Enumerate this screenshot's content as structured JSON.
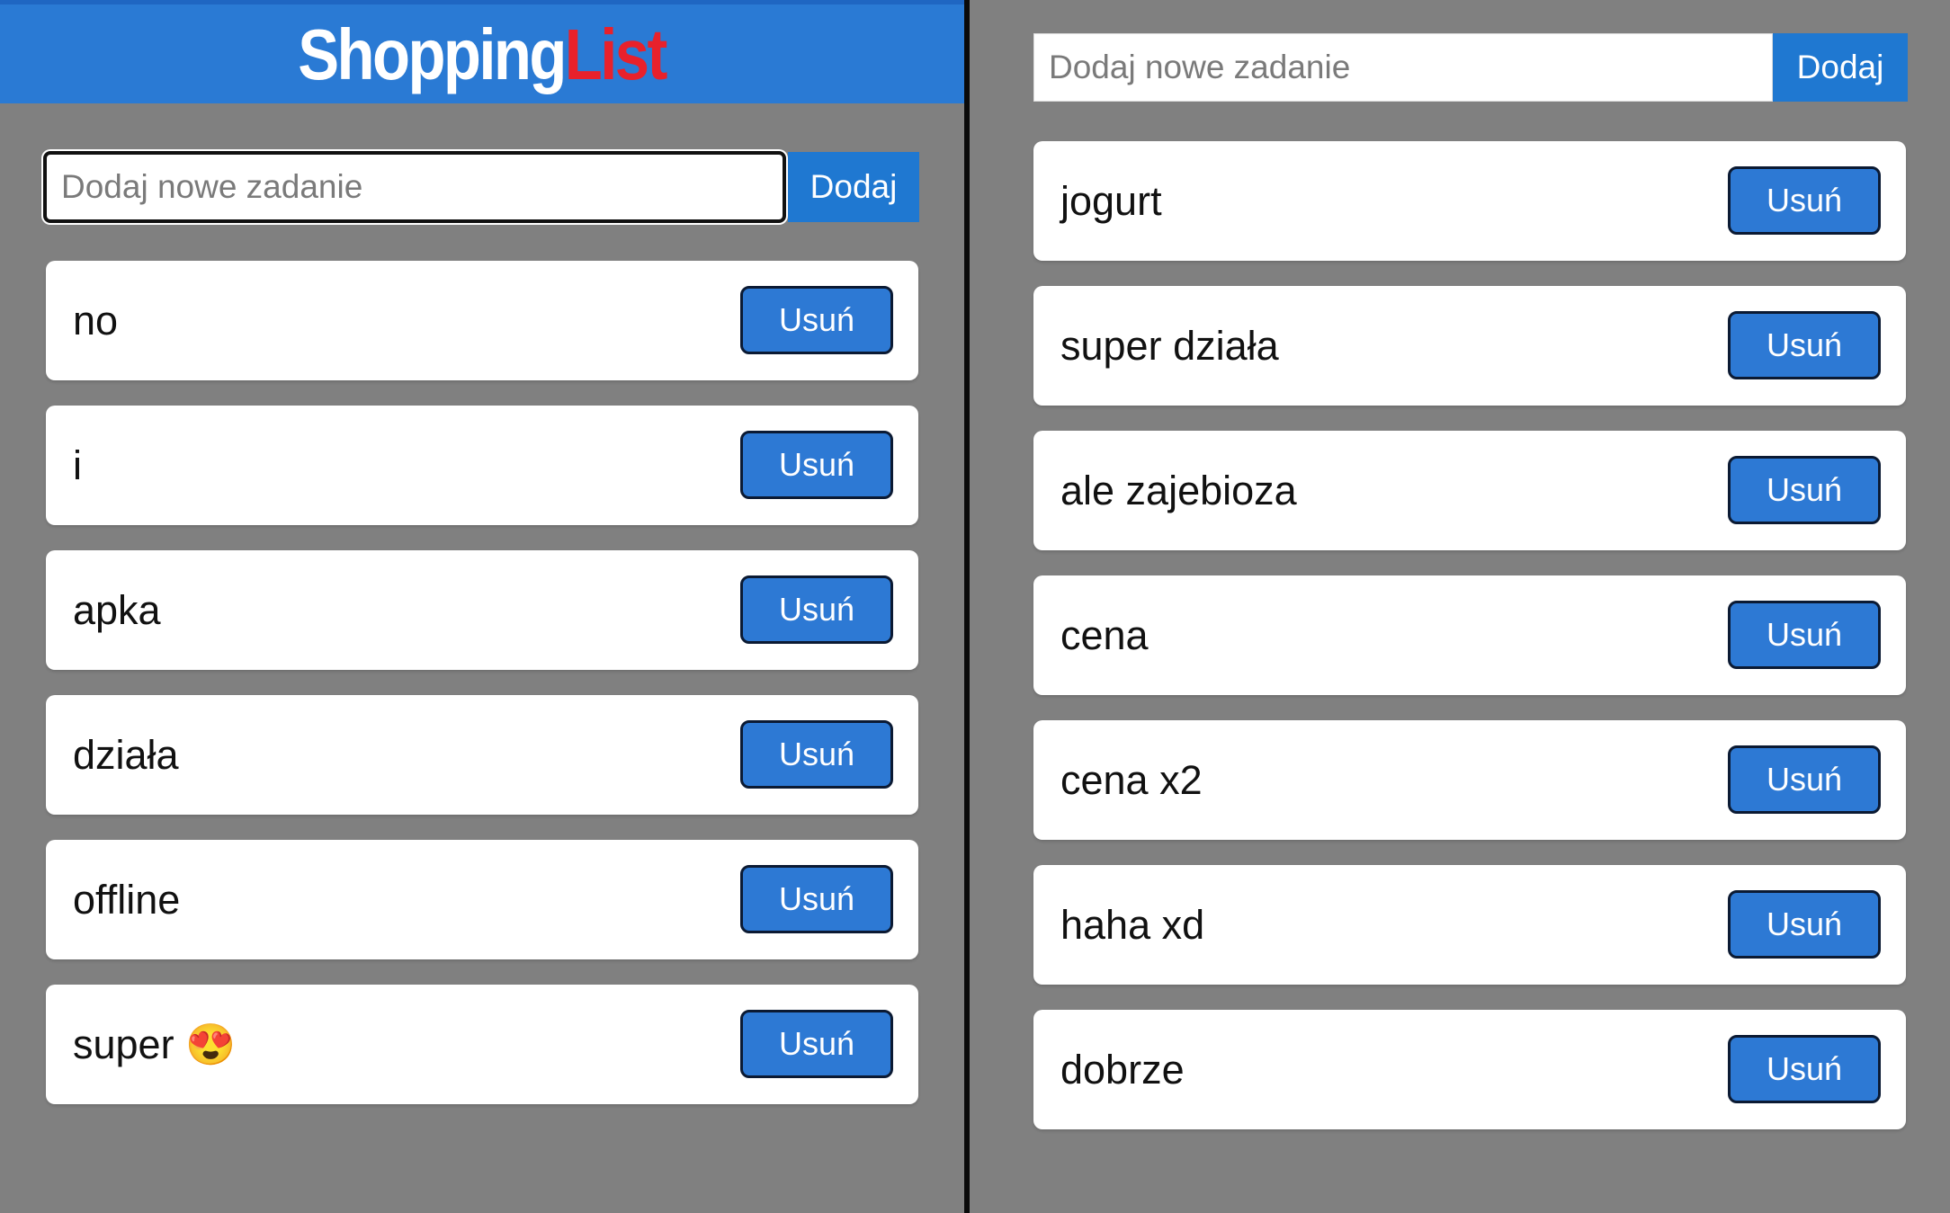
{
  "app": {
    "title_part1": "Shopping",
    "title_part2": "List"
  },
  "colors": {
    "header": "#2a7ad4",
    "title_white": "#ffffff",
    "title_red": "#e8212b",
    "button": "#2d79d4",
    "background": "#808080"
  },
  "left": {
    "input": {
      "placeholder": "Dodaj nowe zadanie",
      "value": ""
    },
    "add_label": "Dodaj",
    "items": [
      {
        "text": "no",
        "delete_label": "Usuń"
      },
      {
        "text": "i",
        "delete_label": "Usuń"
      },
      {
        "text": "apka",
        "delete_label": "Usuń"
      },
      {
        "text": "działa",
        "delete_label": "Usuń"
      },
      {
        "text": "offline",
        "delete_label": "Usuń"
      },
      {
        "text": "super 😍",
        "delete_label": "Usuń"
      }
    ]
  },
  "right": {
    "input": {
      "placeholder": "Dodaj nowe zadanie",
      "value": ""
    },
    "add_label": "Dodaj",
    "items": [
      {
        "text": "jogurt",
        "delete_label": "Usuń"
      },
      {
        "text": "super działa",
        "delete_label": "Usuń"
      },
      {
        "text": "ale zajebioza",
        "delete_label": "Usuń"
      },
      {
        "text": "cena",
        "delete_label": "Usuń"
      },
      {
        "text": "cena x2",
        "delete_label": "Usuń"
      },
      {
        "text": "haha xd",
        "delete_label": "Usuń"
      },
      {
        "text": "dobrze",
        "delete_label": "Usuń"
      }
    ]
  }
}
